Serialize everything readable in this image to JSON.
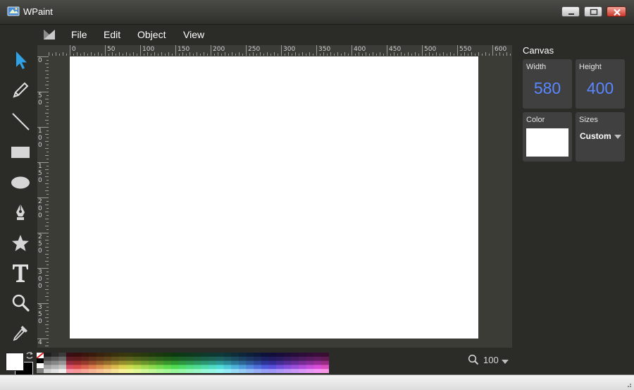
{
  "window": {
    "title": "WPaint"
  },
  "menu": {
    "items": [
      "File",
      "Edit",
      "Object",
      "View"
    ]
  },
  "tools": [
    {
      "name": "select-arrow-icon",
      "active": true
    },
    {
      "name": "pencil-icon"
    },
    {
      "name": "line-icon"
    },
    {
      "name": "rectangle-icon"
    },
    {
      "name": "ellipse-icon"
    },
    {
      "name": "pen-nib-icon"
    },
    {
      "name": "star-icon"
    },
    {
      "name": "text-tool-icon"
    },
    {
      "name": "magnifier-icon"
    },
    {
      "name": "eyedropper-icon"
    }
  ],
  "ruler": {
    "h_labels": [
      "0",
      "50",
      "100",
      "150",
      "200",
      "250",
      "300",
      "350",
      "400",
      "450",
      "500",
      "550",
      "600"
    ],
    "v_labels": [
      "0",
      "50",
      "100",
      "150",
      "200",
      "250",
      "300",
      "350",
      "4"
    ]
  },
  "canvas": {
    "title": "Canvas",
    "width_label": "Width",
    "width_value": "580",
    "height_label": "Height",
    "height_value": "400",
    "color_label": "Color",
    "color_value": "#ffffff",
    "sizes_label": "Sizes",
    "sizes_value": "Custom"
  },
  "colors": {
    "foreground": "#ffffff",
    "background": "#000000",
    "accent_value": "#5a87ff"
  },
  "zoom": {
    "value": "100"
  }
}
